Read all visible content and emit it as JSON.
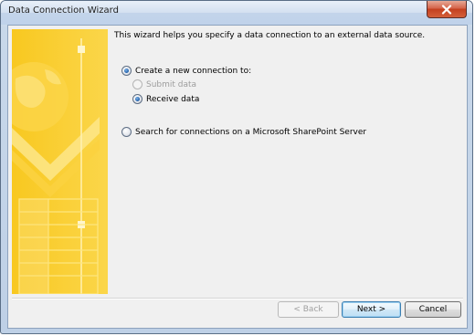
{
  "window": {
    "title": "Data Connection Wizard"
  },
  "main": {
    "intro": "This wizard helps you specify a data connection to an external data source.",
    "options": {
      "create_new": {
        "label": "Create a new connection to:",
        "checked": true
      },
      "submit_data": {
        "label": "Submit data",
        "checked": false,
        "disabled": true
      },
      "receive_data": {
        "label": "Receive data",
        "checked": true
      },
      "search_sharepoint": {
        "label": "Search for connections on a Microsoft SharePoint Server",
        "checked": false
      }
    }
  },
  "buttons": {
    "back": "< Back",
    "next": "Next >",
    "cancel": "Cancel"
  },
  "colors": {
    "banner_primary": "#f7c41c",
    "banner_light": "#ffe57a",
    "accent_blue": "#3c7fb1",
    "close_red": "#c3401f"
  },
  "icons": {
    "close": "close-icon",
    "banner": "wizard-banner-graphic"
  }
}
